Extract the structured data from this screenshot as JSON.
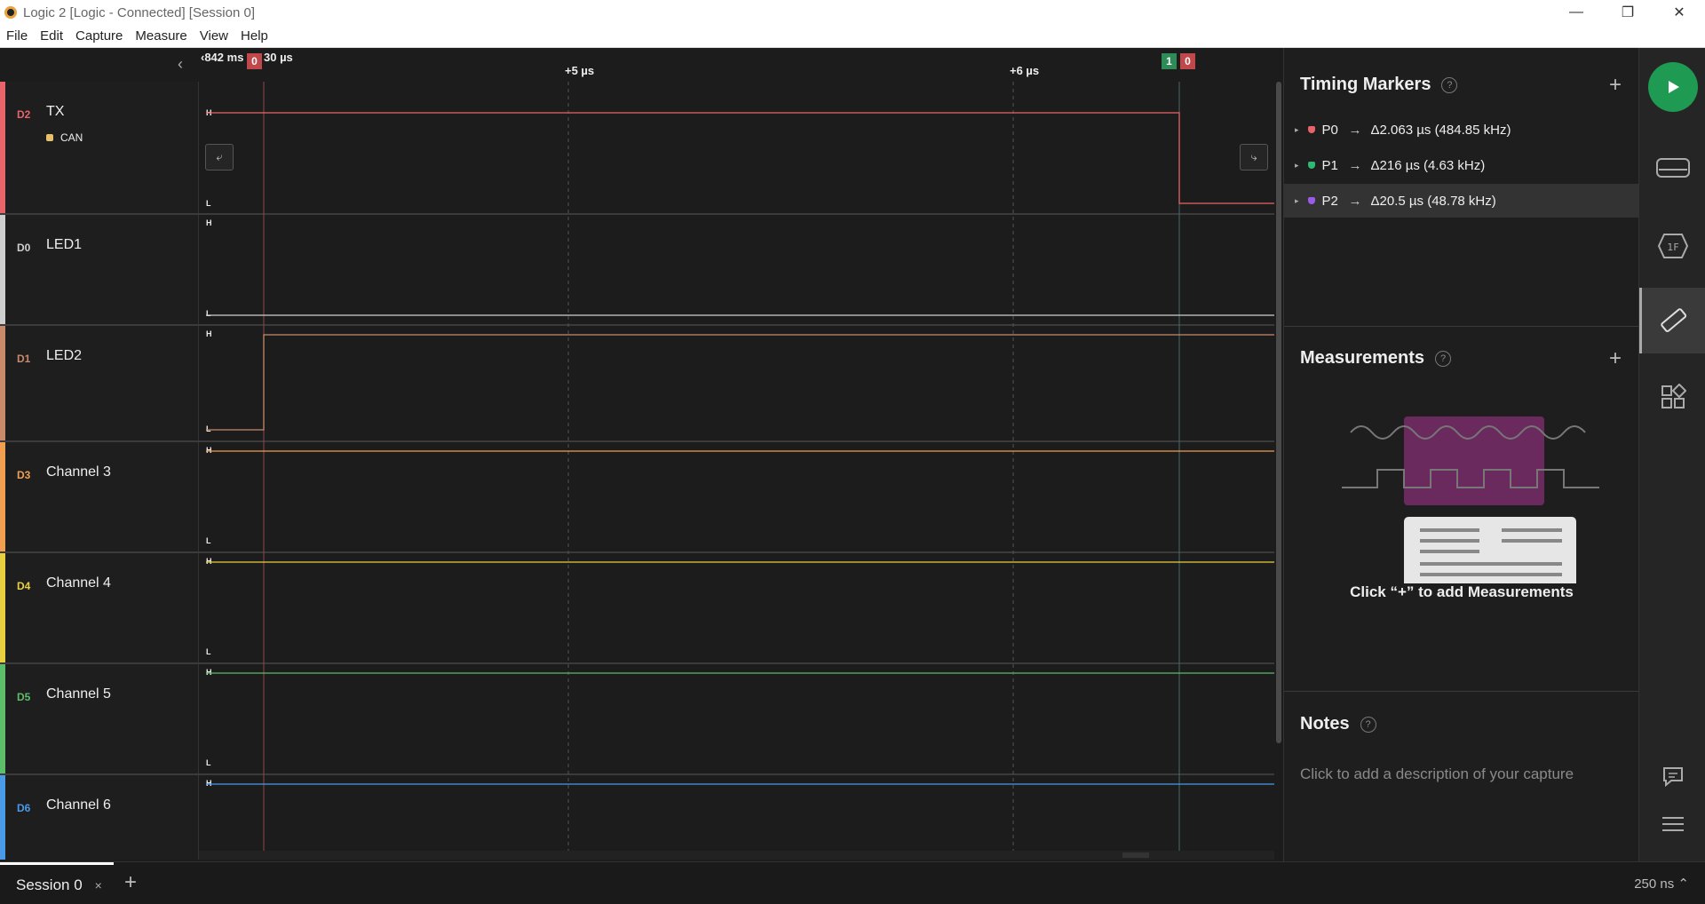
{
  "window": {
    "title": "Logic 2 [Logic - Connected] [Session 0]",
    "minimize": "—",
    "maximize": "❐",
    "close": "✕"
  },
  "menu": [
    "File",
    "Edit",
    "Capture",
    "Measure",
    "View",
    "Help"
  ],
  "timebar": {
    "start_label": "‹842 ms",
    "start_label_suffix": "30 µs",
    "tick_labels": [
      "+5 µs",
      "+6 µs"
    ],
    "marker_flags": [
      {
        "label": "0",
        "color": "#c0474a"
      },
      {
        "label": "1",
        "color": "#2e8b57"
      },
      {
        "label": "0",
        "color": "#c0474a"
      }
    ]
  },
  "channels": [
    {
      "id": "D2",
      "name": "TX",
      "color": "#e8646a",
      "analyzer": "CAN",
      "high": "H",
      "low": "L"
    },
    {
      "id": "D0",
      "name": "LED1",
      "color": "#cfcfcf",
      "high": "H",
      "low": "L"
    },
    {
      "id": "D1",
      "name": "LED2",
      "color": "#c88a6a",
      "high": "H",
      "low": "L"
    },
    {
      "id": "D3",
      "name": "Channel 3",
      "color": "#f0a050",
      "high": "H",
      "low": "L"
    },
    {
      "id": "D4",
      "name": "Channel 4",
      "color": "#e8d040",
      "high": "H",
      "low": "L"
    },
    {
      "id": "D5",
      "name": "Channel 5",
      "color": "#5cbd6a",
      "high": "H",
      "low": "L"
    },
    {
      "id": "D6",
      "name": "Channel 6",
      "color": "#4a9ae8",
      "high": "H"
    }
  ],
  "timing_markers": {
    "title": "Timing Markers",
    "help": "?",
    "add": "+",
    "items": [
      {
        "name": "P0",
        "value": "Δ2.063 µs (484.85 kHz)",
        "color": "#e8646a"
      },
      {
        "name": "P1",
        "value": "Δ216 µs (4.63 kHz)",
        "color": "#2eb872"
      },
      {
        "name": "P2",
        "value": "Δ20.5 µs (48.78 kHz)",
        "color": "#9a5ce8"
      }
    ]
  },
  "measurements": {
    "title": "Measurements",
    "help": "?",
    "add": "+",
    "cta": "Click “+” to add Measurements"
  },
  "notes": {
    "title": "Notes",
    "help": "?",
    "placeholder": "Click to add a description of your capture"
  },
  "bottom": {
    "session_tab": "Session 0",
    "close": "×",
    "add": "+",
    "zoom": "250 ns ⌃"
  },
  "icons": {
    "collapse": "chevron-left-icon",
    "run": "play-icon",
    "device": "device-icon",
    "analyzers": "analyzer-icon",
    "measure": "ruler-icon",
    "extensions": "extensions-icon",
    "feedback": "chat-icon",
    "menu": "hamburger-icon"
  }
}
